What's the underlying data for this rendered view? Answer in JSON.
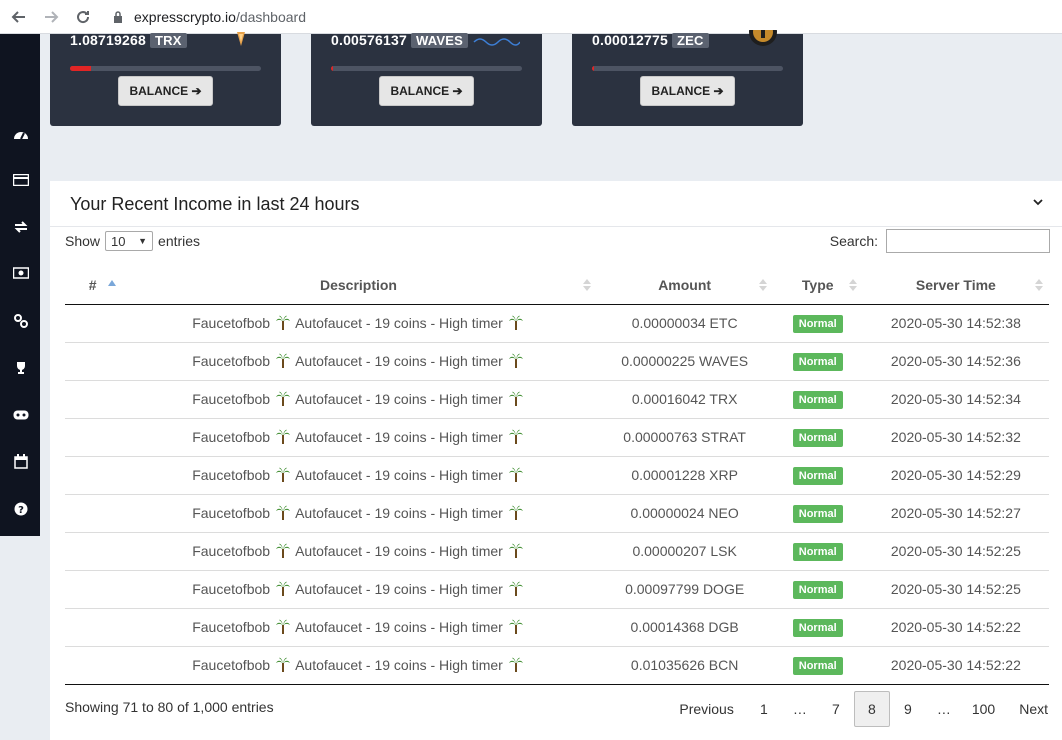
{
  "browser": {
    "url_host": "expresscrypto.io",
    "url_path": "/dashboard"
  },
  "sidebar": {
    "icons": [
      "dashboard-icon",
      "card-icon",
      "exchange-icon",
      "money-icon",
      "link-icon",
      "trophy-icon",
      "gamepad-icon",
      "calendar-icon",
      "help-icon"
    ]
  },
  "cards": [
    {
      "amount": "1.08719268",
      "symbol": "TRX",
      "progress": 0.11,
      "button": "BALANCE ➔"
    },
    {
      "amount": "0.00576137",
      "symbol": "WAVES",
      "progress": 0.01,
      "button": "BALANCE ➔"
    },
    {
      "amount": "0.00012775",
      "symbol": "ZEC",
      "progress": 0.01,
      "button": "BALANCE ➔"
    }
  ],
  "panel": {
    "title": "Your Recent Income in last 24 hours",
    "show_label": "Show",
    "entries_value": "10",
    "entries_label": "entries",
    "search_label": "Search:"
  },
  "table": {
    "headers": [
      "#",
      "Description",
      "Amount",
      "Type",
      "Server Time"
    ],
    "rows": [
      {
        "amount": "0.00000034 ETC",
        "type": "Normal",
        "time": "2020-05-30 14:52:38"
      },
      {
        "amount": "0.00000225 WAVES",
        "type": "Normal",
        "time": "2020-05-30 14:52:36"
      },
      {
        "amount": "0.00016042 TRX",
        "type": "Normal",
        "time": "2020-05-30 14:52:34"
      },
      {
        "amount": "0.00000763 STRAT",
        "type": "Normal",
        "time": "2020-05-30 14:52:32"
      },
      {
        "amount": "0.00001228 XRP",
        "type": "Normal",
        "time": "2020-05-30 14:52:29"
      },
      {
        "amount": "0.00000024 NEO",
        "type": "Normal",
        "time": "2020-05-30 14:52:27"
      },
      {
        "amount": "0.00000207 LSK",
        "type": "Normal",
        "time": "2020-05-30 14:52:25"
      },
      {
        "amount": "0.00097799 DOGE",
        "type": "Normal",
        "time": "2020-05-30 14:52:25"
      },
      {
        "amount": "0.00014368 DGB",
        "type": "Normal",
        "time": "2020-05-30 14:52:22"
      },
      {
        "amount": "0.01035626 BCN",
        "type": "Normal",
        "time": "2020-05-30 14:52:22"
      }
    ],
    "desc_source": "Faucetofbob",
    "desc_text": "Autofaucet - 19 coins - High timer"
  },
  "footer": {
    "info": "Showing 71 to 80 of 1,000 entries",
    "pages": [
      "Previous",
      "1",
      "…",
      "7",
      "8",
      "9",
      "…",
      "100",
      "Next"
    ],
    "active_page": "8"
  },
  "colors": {
    "sidebar_bg": "#0f1420",
    "card_bg": "#2b3240",
    "badge_green": "#5cb85c",
    "progress_red": "#e12525"
  }
}
